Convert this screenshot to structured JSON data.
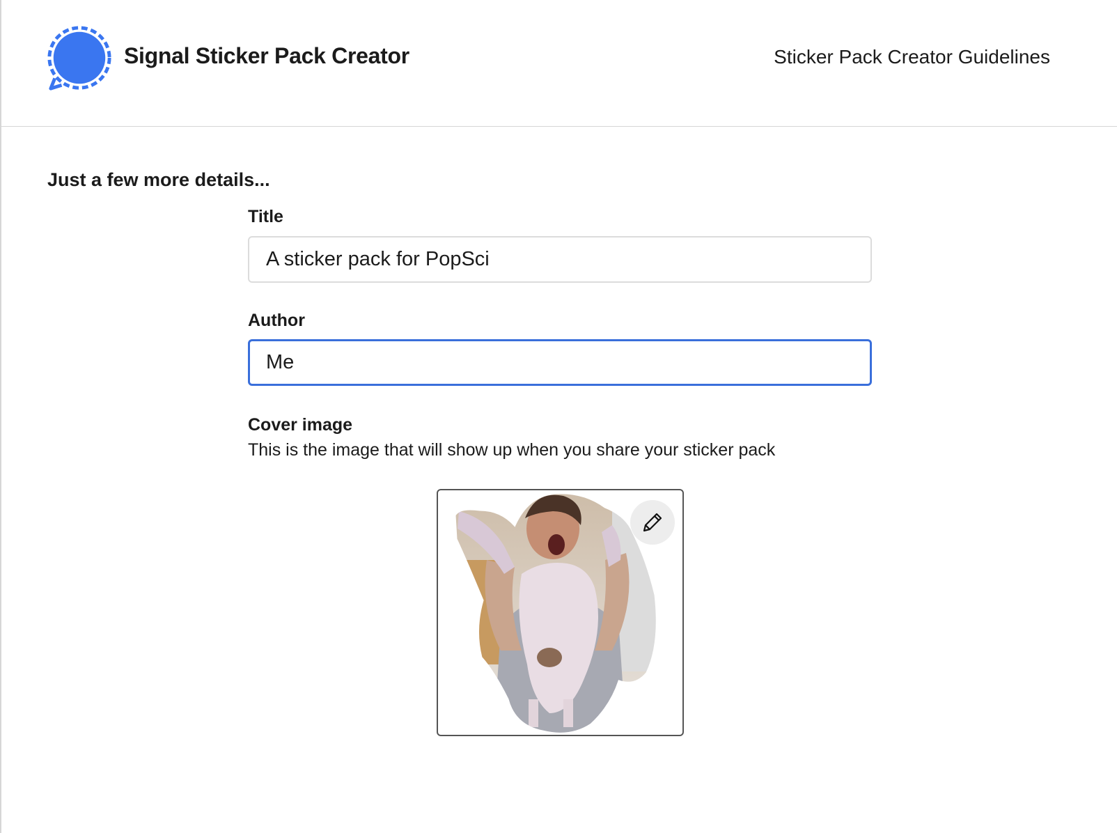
{
  "header": {
    "app_title": "Signal Sticker Pack Creator",
    "guidelines_link": "Sticker Pack Creator Guidelines",
    "logo_icon": "signal-chat-bubble-icon"
  },
  "form": {
    "heading": "Just a few more details...",
    "title": {
      "label": "Title",
      "value": "A sticker pack for PopSci"
    },
    "author": {
      "label": "Author",
      "value": "Me"
    },
    "cover": {
      "label": "Cover image",
      "description": "This is the image that will show up when you share your sticker pack",
      "edit_icon": "pencil-icon"
    }
  },
  "colors": {
    "accent": "#3a6fdb",
    "logo_blue": "#3a76f0",
    "border": "#dcdcdc"
  }
}
